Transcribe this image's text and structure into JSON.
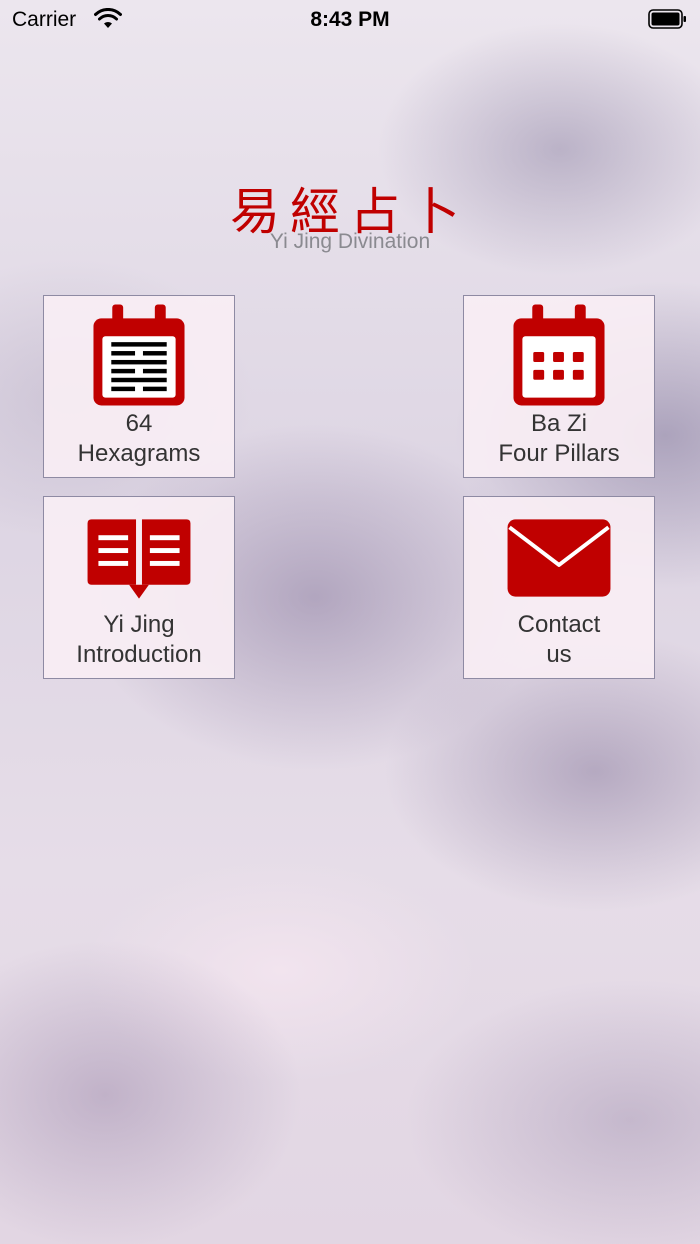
{
  "status_bar": {
    "carrier": "Carrier",
    "time": "8:43 PM"
  },
  "header": {
    "title_cn": "易經占卜",
    "title_en": "Yi Jing Divination"
  },
  "tiles": [
    {
      "icon": "hexagram-calendar-icon",
      "line1": "64",
      "line2": "Hexagrams"
    },
    {
      "icon": "calendar-icon",
      "line1": "Ba Zi",
      "line2": "Four Pillars"
    },
    {
      "icon": "open-book-icon",
      "line1": "Yi Jing",
      "line2": "Introduction"
    },
    {
      "icon": "envelope-icon",
      "line1": "Contact",
      "line2": "us"
    }
  ],
  "colors": {
    "accent": "#c00000",
    "tile_bg": "#f9eef4",
    "tile_border": "#8e8aa3"
  }
}
